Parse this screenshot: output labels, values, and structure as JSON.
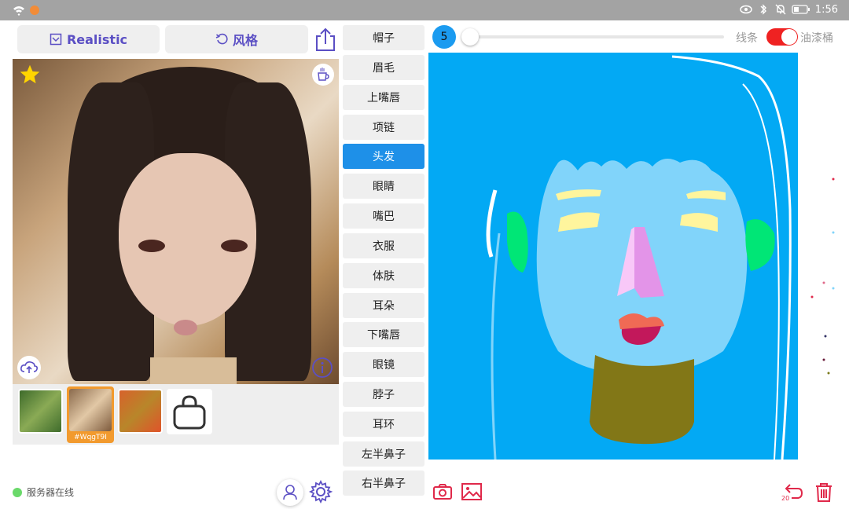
{
  "status_bar": {
    "time": "1:56",
    "icons": [
      "wifi-icon",
      "notification-icon",
      "eye-icon",
      "bluetooth-icon",
      "mute-icon",
      "battery-icon"
    ]
  },
  "toolbar": {
    "realistic_label": "Realistic",
    "style_label": "风格"
  },
  "thumbnails": {
    "selected_tag": "#WqgT9I"
  },
  "categories": [
    {
      "label": "帽子"
    },
    {
      "label": "眉毛"
    },
    {
      "label": "上嘴唇"
    },
    {
      "label": "项链"
    },
    {
      "label": "头发",
      "selected": true
    },
    {
      "label": "眼睛"
    },
    {
      "label": "嘴巴"
    },
    {
      "label": "衣服"
    },
    {
      "label": "体肤"
    },
    {
      "label": "耳朵"
    },
    {
      "label": "下嘴唇"
    },
    {
      "label": "眼镜"
    },
    {
      "label": "脖子"
    },
    {
      "label": "耳环"
    },
    {
      "label": "左半鼻子"
    },
    {
      "label": "右半鼻子"
    }
  ],
  "brush": {
    "size": "5",
    "mode_line": "线条",
    "mode_bucket": "油漆桶",
    "bucket_enabled": true
  },
  "server": {
    "status": "服务器在线"
  },
  "history": {
    "undo_count": "20"
  },
  "colors": {
    "accent": "#5b4fc4",
    "selected_category": "#1e90e8",
    "canvas_hair": "#03a9f4",
    "face": "#81d4fa",
    "toggle_on": "#ef2222",
    "danger_icon": "#e0294a"
  }
}
